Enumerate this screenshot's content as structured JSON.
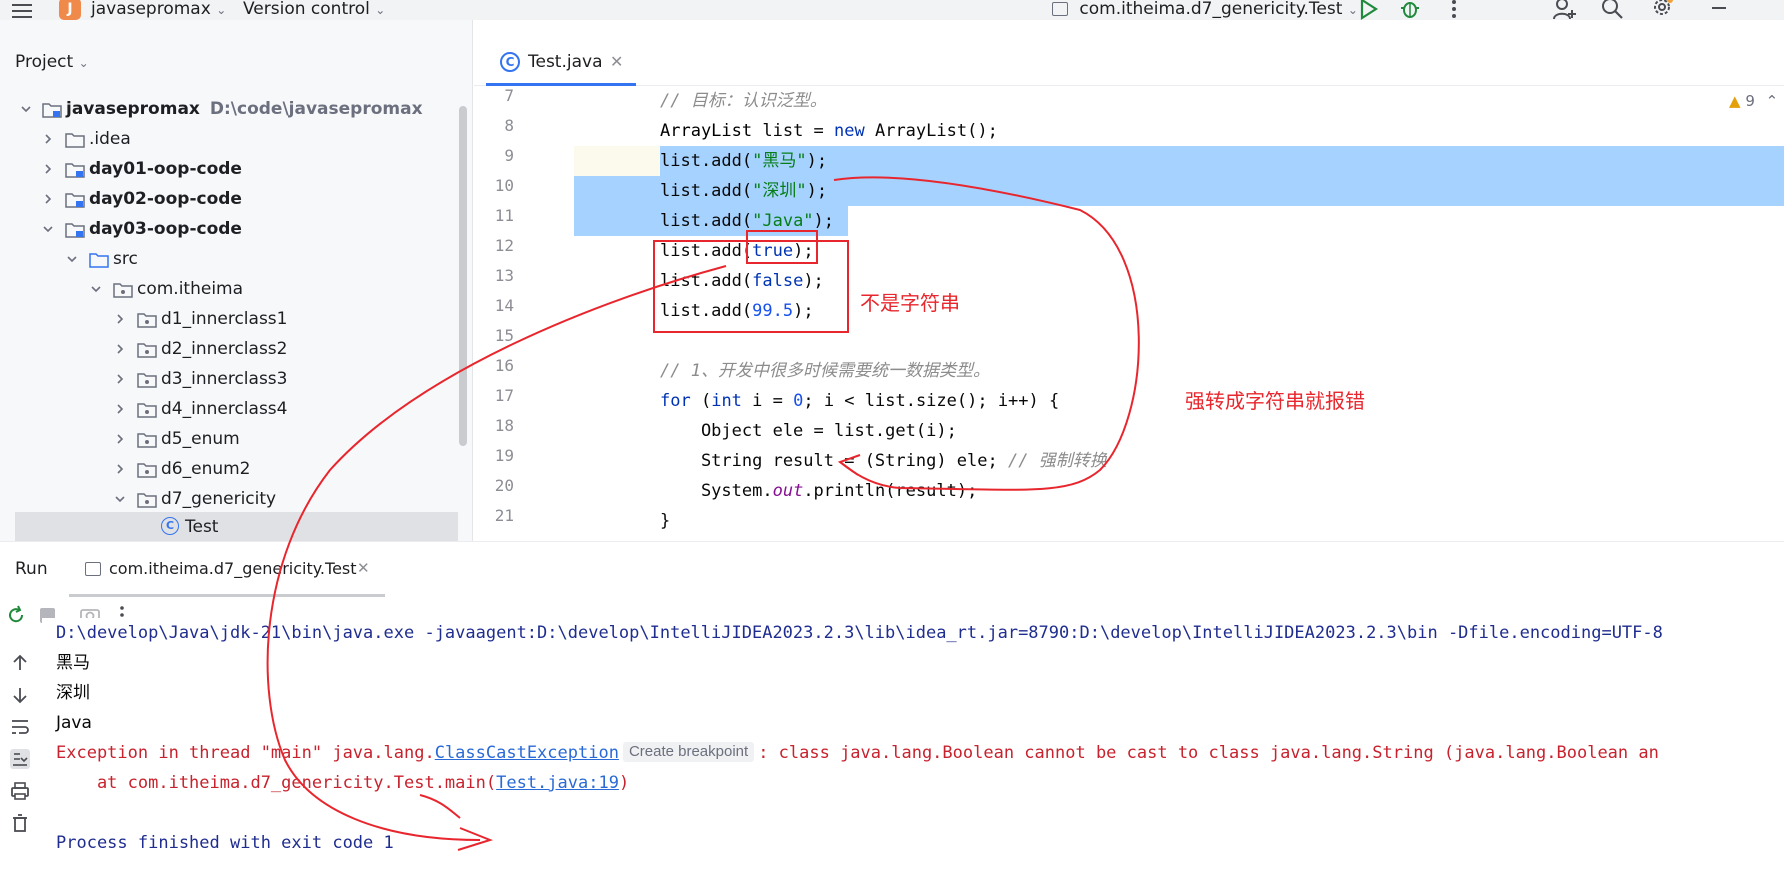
{
  "titlebar": {
    "project_badge": "J",
    "project_name": "javasepromax",
    "vcs": "Version control",
    "run_config": "com.itheima.d7_genericity.Test"
  },
  "project_panel": {
    "title": "Project",
    "tree": [
      {
        "label": "javasepromax",
        "hint": "D:\\code\\javasepromax",
        "icon": "module-icon",
        "expanded": true
      },
      {
        "label": ".idea",
        "icon": "folder-icon",
        "expanded": false
      },
      {
        "label": "day01-oop-code",
        "icon": "module-icon",
        "expanded": false
      },
      {
        "label": "day02-oop-code",
        "icon": "module-icon",
        "expanded": false
      },
      {
        "label": "day03-oop-code",
        "icon": "module-icon",
        "expanded": true
      },
      {
        "label": "src",
        "icon": "source-folder-icon",
        "expanded": true
      },
      {
        "label": "com.itheima",
        "icon": "package-icon",
        "expanded": true
      },
      {
        "label": "d1_innerclass1",
        "icon": "package-icon",
        "expanded": false
      },
      {
        "label": "d2_innerclass2",
        "icon": "package-icon",
        "expanded": false
      },
      {
        "label": "d3_innerclass3",
        "icon": "package-icon",
        "expanded": false
      },
      {
        "label": "d4_innerclass4",
        "icon": "package-icon",
        "expanded": false
      },
      {
        "label": "d5_enum",
        "icon": "package-icon",
        "expanded": false
      },
      {
        "label": "d6_enum2",
        "icon": "package-icon",
        "expanded": false
      },
      {
        "label": "d7_genericity",
        "icon": "package-icon",
        "expanded": true
      },
      {
        "label": "Test",
        "icon": "class-icon",
        "selected": true
      }
    ]
  },
  "editor": {
    "tab_label": "Test.java",
    "warnings": "9",
    "line_numbers": [
      "7",
      "8",
      "9",
      "10",
      "11",
      "12",
      "13",
      "14",
      "15",
      "16",
      "17",
      "18",
      "19",
      "20",
      "21"
    ],
    "code": {
      "l7_comment": "// 目标：认识泛型。",
      "l8_type": "ArrayList",
      "l8_var": " list = ",
      "l8_new": "new",
      "l8_ctor": " ArrayList",
      "l8_end": "();",
      "l9_call": "list.add(",
      "l9_str": "\"黑马\"",
      "l9_end": ");",
      "l10_call": "list.add(",
      "l10_str": "\"深圳\"",
      "l10_end": ");",
      "l11_call": "list.add(",
      "l11_str": "\"Java\"",
      "l11_end": ");",
      "l12_call": "list.add(",
      "l12_val": "true",
      "l12_end": ");",
      "l13_call": "list.add(",
      "l13_val": "false",
      "l13_end": ");",
      "l14_call": "list.add(",
      "l14_val": "99.5",
      "l14_end": ");",
      "l16_comment": "// 1、开发中很多时候需要统一数据类型。",
      "l17_for": "for",
      "l17_a": " (",
      "l17_int": "int",
      "l17_b": " i = ",
      "l17_zero": "0",
      "l17_c": "; i < list.size(); i++) {",
      "l18": "    Object ele = list.get(i);",
      "l19_a": "    String result = (String) ele; ",
      "l19_comment": "// 强制转换",
      "l20_a": "    System.",
      "l20_out": "out",
      "l20_b": ".println(result);",
      "l21": "}"
    }
  },
  "run_panel": {
    "title": "Run",
    "tab_label": "com.itheima.d7_genericity.Test",
    "console": {
      "cmd": "D:\\develop\\Java\\jdk-21\\bin\\java.exe -javaagent:D:\\develop\\IntelliJIDEA2023.2.3\\lib\\idea_rt.jar=8790:D:\\develop\\IntelliJIDEA2023.2.3\\bin -Dfile.encoding=UTF-8",
      "out1": "黑马",
      "out2": "深圳",
      "out3": "Java",
      "err_prefix": "Exception in thread \"main\" java.lang.",
      "err_link": "ClassCastException",
      "bp_hint": "Create breakpoint",
      "err_suffix": ": class java.lang.Boolean cannot be cast to class java.lang.String (java.lang.Boolean an",
      "at_prefix": "    at com.itheima.d7_genericity.Test.main(",
      "at_link": "Test.java:19",
      "at_suffix": ")",
      "exit": "Process finished with exit code 1"
    }
  },
  "annotations": {
    "not_string": "不是字符串",
    "cast_error": "强转成字符串就报错"
  },
  "colors": {
    "accent": "#3574f0",
    "selection": "#a6d2ff",
    "annotation": "#e8262d",
    "error": "#c7222d"
  }
}
